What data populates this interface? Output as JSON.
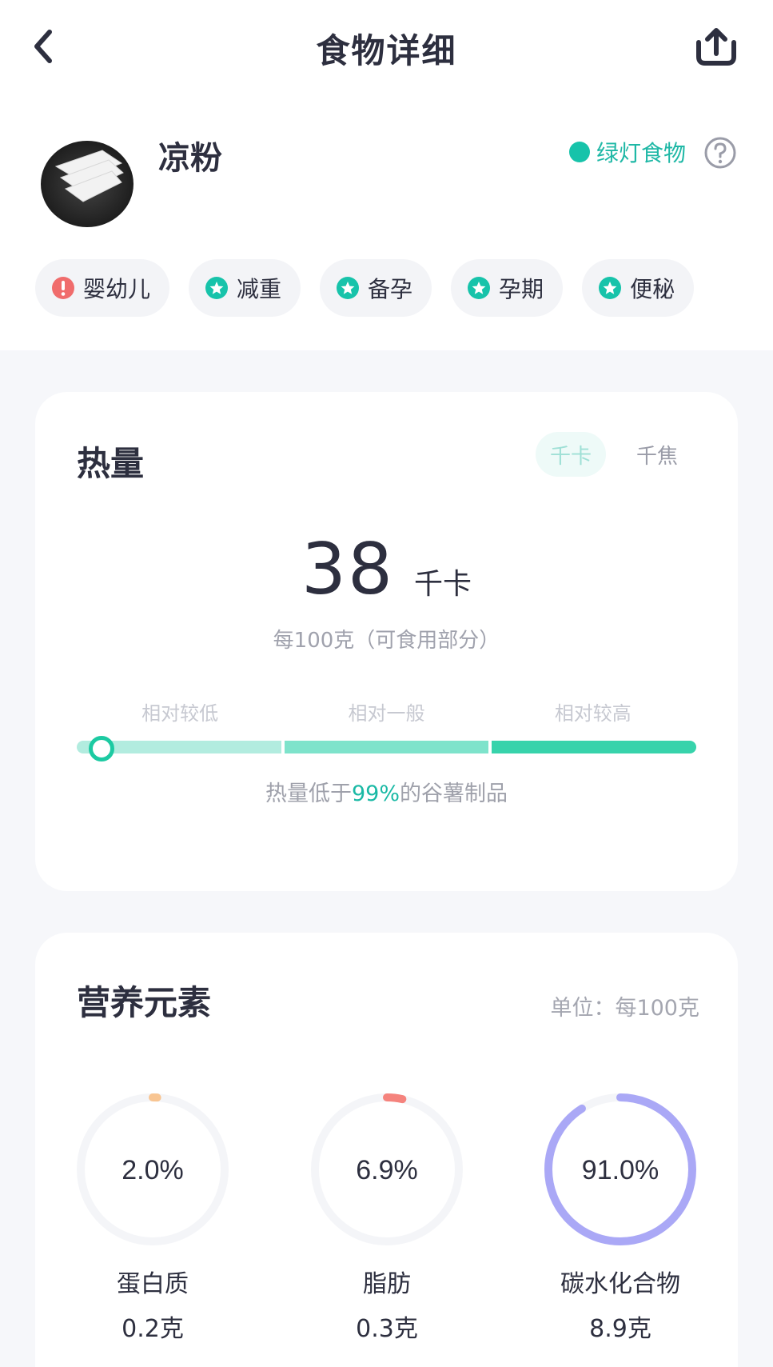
{
  "nav": {
    "title": "食物详细"
  },
  "food": {
    "name": "凉粉",
    "light_label": "绿灯食物",
    "light_color": "#17c3aa"
  },
  "tags": [
    {
      "label": "婴幼儿",
      "icon": "warning-icon",
      "color": "#f06c6c"
    },
    {
      "label": "减重",
      "icon": "star-badge-icon",
      "color": "#17c3aa"
    },
    {
      "label": "备孕",
      "icon": "star-badge-icon",
      "color": "#17c3aa"
    },
    {
      "label": "孕期",
      "icon": "star-badge-icon",
      "color": "#17c3aa"
    },
    {
      "label": "便秘",
      "icon": "star-badge-icon",
      "color": "#17c3aa"
    }
  ],
  "energy": {
    "title": "热量",
    "units": [
      "千卡",
      "千焦"
    ],
    "active_unit": "千卡",
    "value": "38",
    "value_unit": "千卡",
    "per": "每100克（可食用部分）",
    "levels": [
      "相对较低",
      "相对一般",
      "相对较高"
    ],
    "level_position": 0.03,
    "compare_prefix": "热量低于",
    "compare_pct": "99%",
    "compare_suffix": "的谷薯制品"
  },
  "nutrients": {
    "title": "营养元素",
    "unit_note": "单位：每100克",
    "items": [
      {
        "name": "蛋白质",
        "percent_label": "2.0%",
        "percent": 2.0,
        "amount": "0.2克",
        "color": "#f8c592"
      },
      {
        "name": "脂肪",
        "percent_label": "6.9%",
        "percent": 6.9,
        "amount": "0.3克",
        "color": "#f5837d"
      },
      {
        "name": "碳水化合物",
        "percent_label": "91.0%",
        "percent": 91.0,
        "amount": "8.9克",
        "color": "#aaa8f6"
      }
    ]
  }
}
